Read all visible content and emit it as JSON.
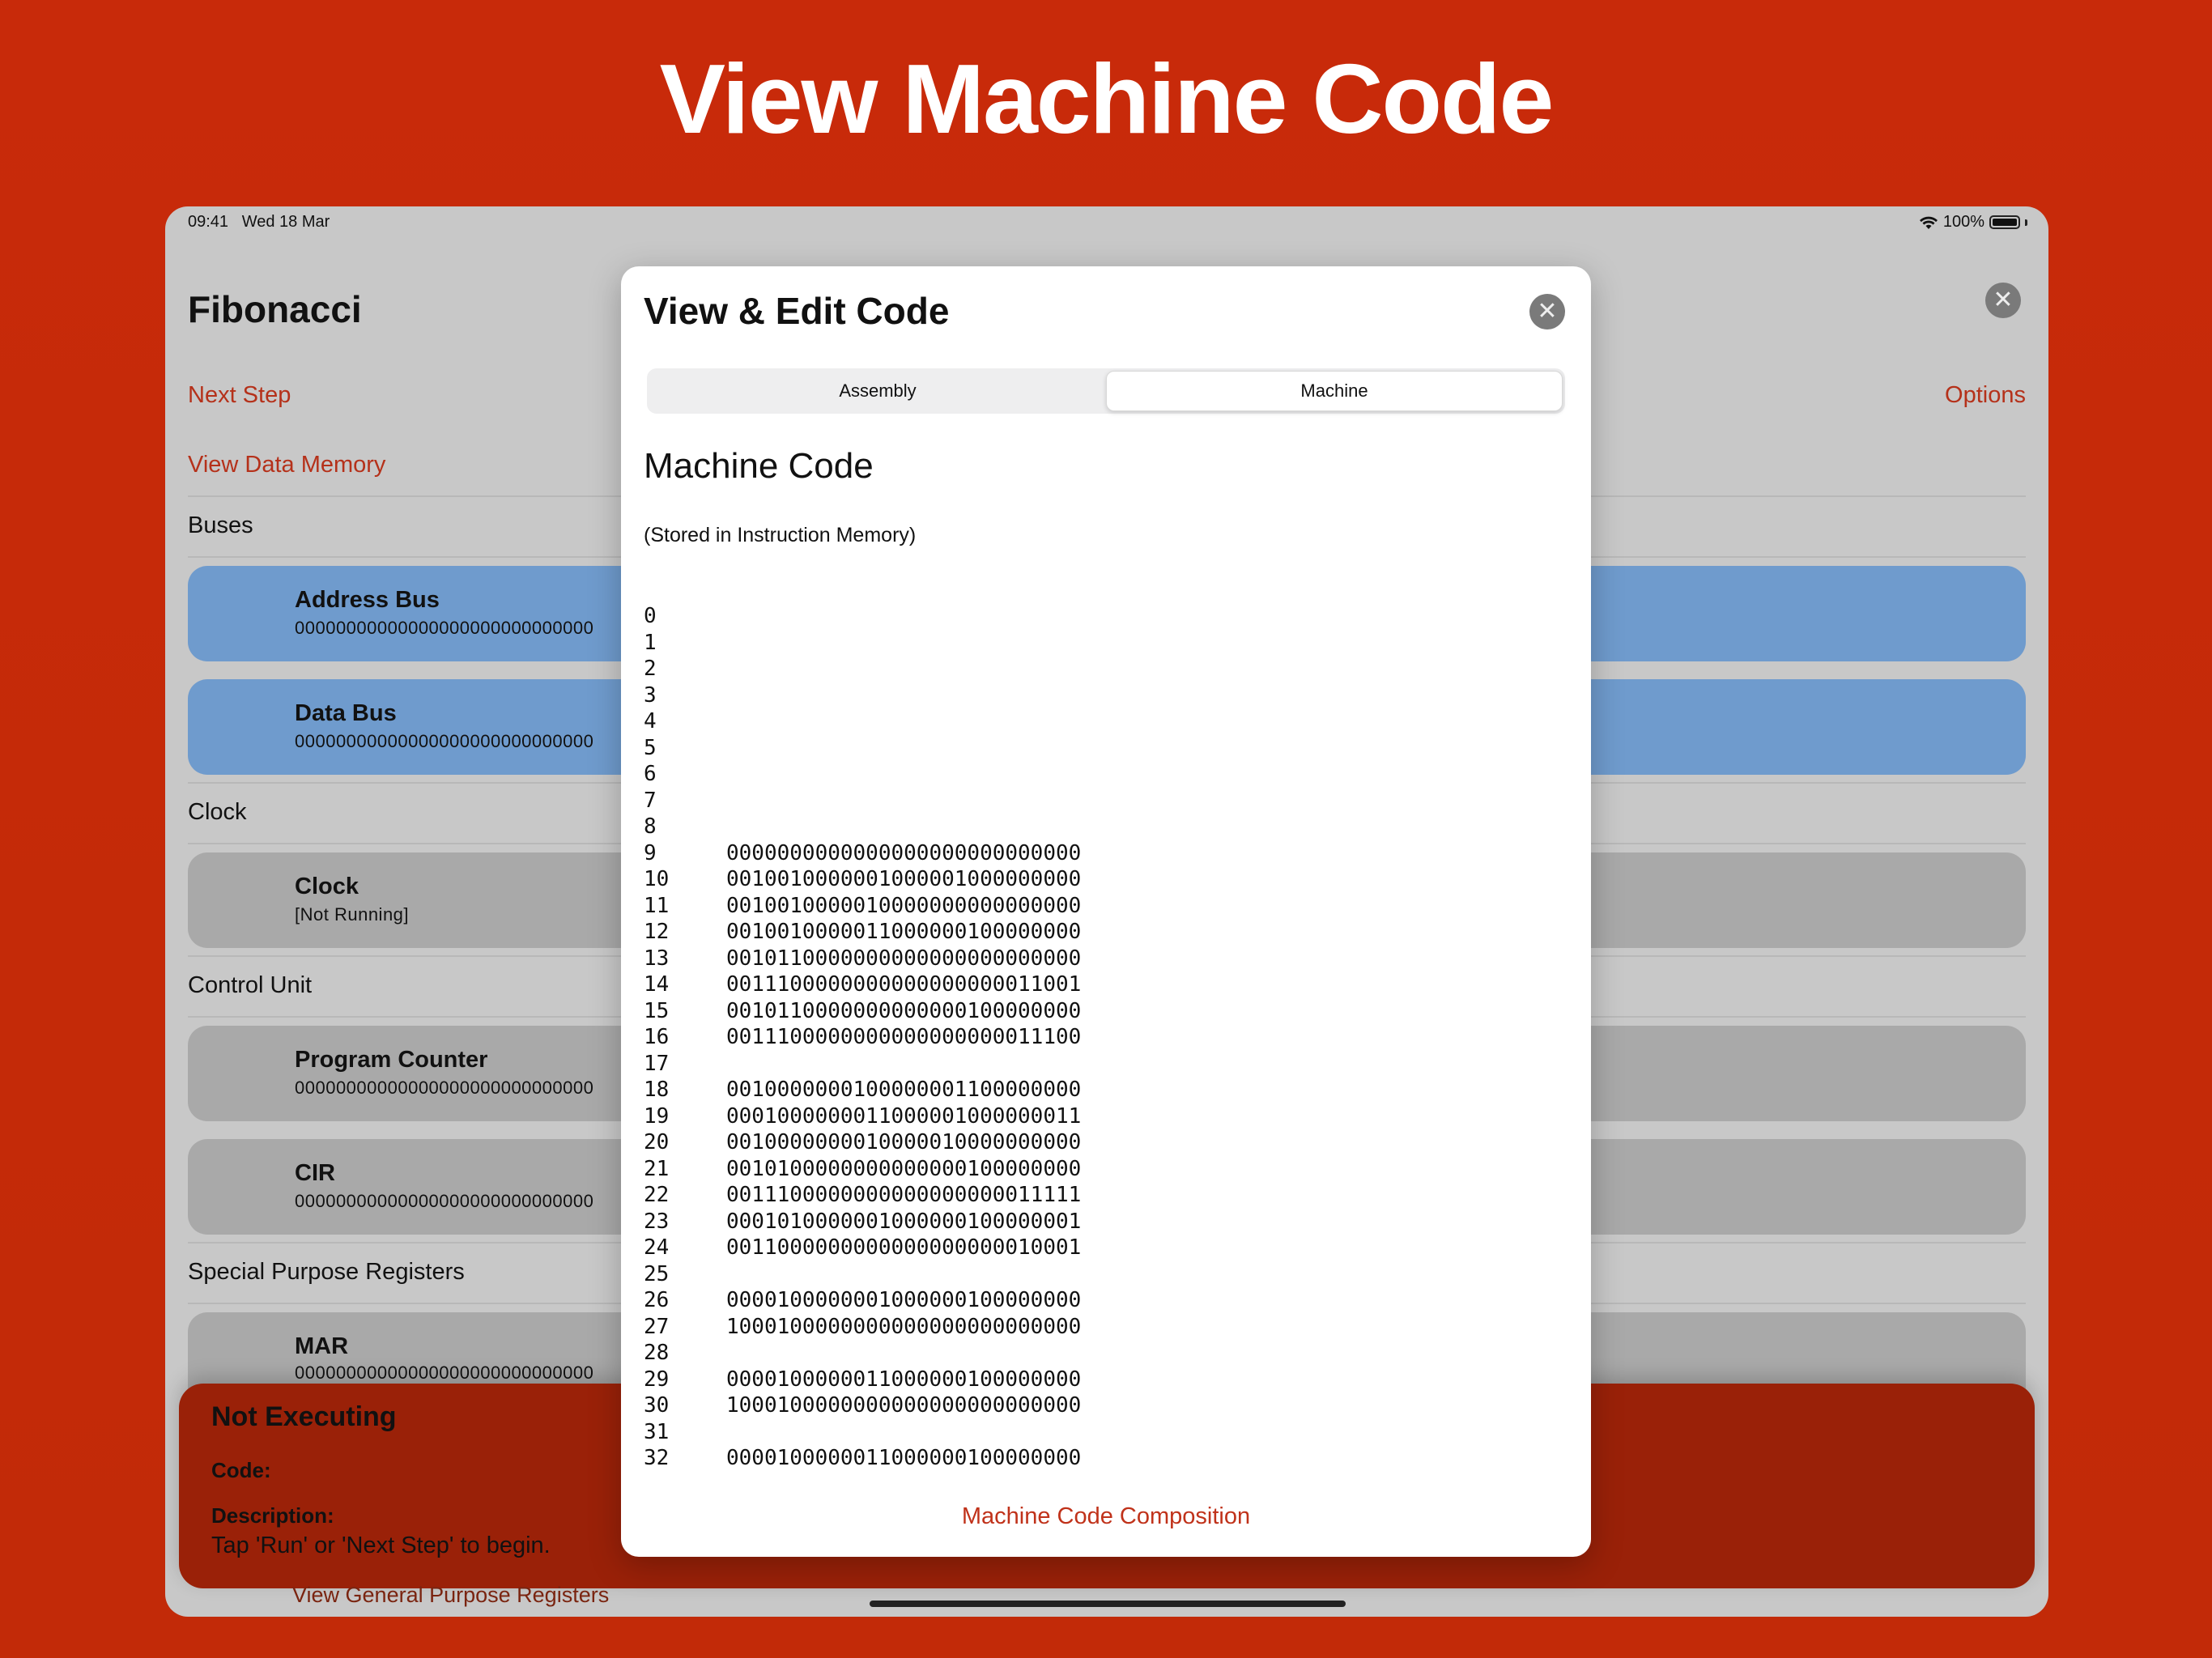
{
  "hero": {
    "title": "View Machine Code"
  },
  "status": {
    "time": "09:41",
    "date": "Wed 18 Mar",
    "battery": "100%"
  },
  "app": {
    "title": "Fibonacci",
    "next_step": "Next Step",
    "options": "Options",
    "view_data_memory": "View Data Memory",
    "bottom_link": "View General Purpose Registers"
  },
  "sections": {
    "buses": "Buses",
    "clock": "Clock",
    "control_unit": "Control Unit",
    "special_registers": "Special Purpose Registers"
  },
  "cards": {
    "address_bus": {
      "name": "Address Bus",
      "value": "00000000000000000000000000000"
    },
    "data_bus": {
      "name": "Data Bus",
      "value": "00000000000000000000000000000"
    },
    "clock": {
      "name": "Clock",
      "value": "[Not Running]"
    },
    "program_counter": {
      "name": "Program Counter",
      "value": "00000000000000000000000000000"
    },
    "cir": {
      "name": "CIR",
      "value": "00000000000000000000000000000"
    },
    "mar": {
      "name": "MAR",
      "value": "00000000000000000000000000000"
    }
  },
  "exec": {
    "title": "Not Executing",
    "code_label": "Code:",
    "desc_label": "Description:",
    "desc": "Tap 'Run' or 'Next Step' to begin."
  },
  "modal": {
    "title": "View & Edit Code",
    "tab_assembly": "Assembly",
    "tab_machine": "Machine",
    "selected_tab": "Machine",
    "heading": "Machine Code",
    "subtitle": "(Stored in Instruction Memory)",
    "footer_link": "Machine Code Composition",
    "lines": [
      {
        "n": "0",
        "code": ""
      },
      {
        "n": "1",
        "code": ""
      },
      {
        "n": "2",
        "code": ""
      },
      {
        "n": "3",
        "code": ""
      },
      {
        "n": "4",
        "code": ""
      },
      {
        "n": "5",
        "code": ""
      },
      {
        "n": "6",
        "code": ""
      },
      {
        "n": "7",
        "code": ""
      },
      {
        "n": "8",
        "code": ""
      },
      {
        "n": "9",
        "code": "0000000000000000000000000000"
      },
      {
        "n": "10",
        "code": "0010010000001000001000000000"
      },
      {
        "n": "11",
        "code": "0010010000010000000000000000"
      },
      {
        "n": "12",
        "code": "0010010000011000000100000000"
      },
      {
        "n": "13",
        "code": "0010110000000000000000000000"
      },
      {
        "n": "14",
        "code": "0011100000000000000000011001"
      },
      {
        "n": "15",
        "code": "0010110000000000000100000000"
      },
      {
        "n": "16",
        "code": "0011100000000000000000011100"
      },
      {
        "n": "17",
        "code": ""
      },
      {
        "n": "18",
        "code": "0010000000100000001100000000"
      },
      {
        "n": "19",
        "code": "0001000000011000001000000011"
      },
      {
        "n": "20",
        "code": "0010000000010000010000000000"
      },
      {
        "n": "21",
        "code": "0010100000000000000100000000"
      },
      {
        "n": "22",
        "code": "0011100000000000000000011111"
      },
      {
        "n": "23",
        "code": "0001010000001000000100000001"
      },
      {
        "n": "24",
        "code": "0011000000000000000000010001"
      },
      {
        "n": "25",
        "code": ""
      },
      {
        "n": "26",
        "code": "0000100000001000000100000000"
      },
      {
        "n": "27",
        "code": "1000100000000000000000000000"
      },
      {
        "n": "28",
        "code": ""
      },
      {
        "n": "29",
        "code": "0000100000011000000100000000"
      },
      {
        "n": "30",
        "code": "1000100000000000000000000000"
      },
      {
        "n": "31",
        "code": ""
      },
      {
        "n": "32",
        "code": "0000100000011000000100000000"
      }
    ]
  },
  "icons": {
    "close": "close-icon",
    "wifi": "wifi-icon",
    "battery": "battery-icon"
  },
  "colors": {
    "background": "#c42a08",
    "accent_link": "#c0321a",
    "bus_card": "#6f9bcd",
    "register_card": "#a9a9a9",
    "exec_panel": "#9a2108"
  }
}
